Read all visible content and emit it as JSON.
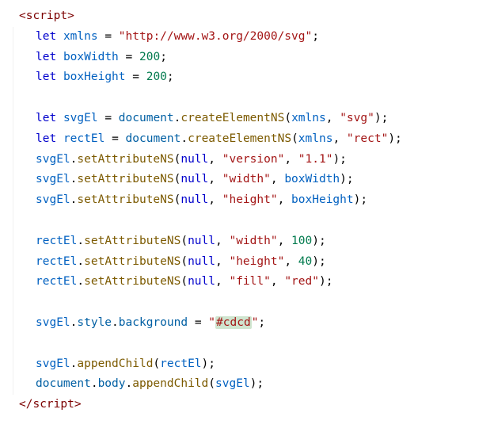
{
  "lines": [
    {
      "cls": "first",
      "tokens": [
        {
          "t": "<",
          "c": "tag-bracket"
        },
        {
          "t": "script",
          "c": "tag-name"
        },
        {
          "t": ">",
          "c": "tag-bracket"
        }
      ]
    },
    {
      "tokens": [
        {
          "t": "let",
          "c": "kw"
        },
        {
          "t": " "
        },
        {
          "t": "xmlns",
          "c": "var"
        },
        {
          "t": " "
        },
        {
          "t": "=",
          "c": "op"
        },
        {
          "t": " "
        },
        {
          "t": "\"http://www.w3.org/2000/svg\"",
          "c": "str"
        },
        {
          "t": ";",
          "c": "op"
        }
      ]
    },
    {
      "tokens": [
        {
          "t": "let",
          "c": "kw"
        },
        {
          "t": " "
        },
        {
          "t": "boxWidth",
          "c": "var"
        },
        {
          "t": " "
        },
        {
          "t": "=",
          "c": "op"
        },
        {
          "t": " "
        },
        {
          "t": "200",
          "c": "num"
        },
        {
          "t": ";",
          "c": "op"
        }
      ]
    },
    {
      "tokens": [
        {
          "t": "let",
          "c": "kw"
        },
        {
          "t": " "
        },
        {
          "t": "boxHeight",
          "c": "var"
        },
        {
          "t": " "
        },
        {
          "t": "=",
          "c": "op"
        },
        {
          "t": " "
        },
        {
          "t": "200",
          "c": "num"
        },
        {
          "t": ";",
          "c": "op"
        }
      ]
    },
    {
      "tokens": []
    },
    {
      "tokens": [
        {
          "t": "let",
          "c": "kw"
        },
        {
          "t": " "
        },
        {
          "t": "svgEl",
          "c": "var"
        },
        {
          "t": " "
        },
        {
          "t": "=",
          "c": "op"
        },
        {
          "t": " "
        },
        {
          "t": "document",
          "c": "obj"
        },
        {
          "t": ".",
          "c": "op"
        },
        {
          "t": "createElementNS",
          "c": "fn"
        },
        {
          "t": "(",
          "c": "op"
        },
        {
          "t": "xmlns",
          "c": "var"
        },
        {
          "t": ", ",
          "c": "op"
        },
        {
          "t": "\"svg\"",
          "c": "str"
        },
        {
          "t": ");",
          "c": "op"
        }
      ]
    },
    {
      "tokens": [
        {
          "t": "let",
          "c": "kw"
        },
        {
          "t": " "
        },
        {
          "t": "rectEl",
          "c": "var"
        },
        {
          "t": " "
        },
        {
          "t": "=",
          "c": "op"
        },
        {
          "t": " "
        },
        {
          "t": "document",
          "c": "obj"
        },
        {
          "t": ".",
          "c": "op"
        },
        {
          "t": "createElementNS",
          "c": "fn"
        },
        {
          "t": "(",
          "c": "op"
        },
        {
          "t": "xmlns",
          "c": "var"
        },
        {
          "t": ", ",
          "c": "op"
        },
        {
          "t": "\"rect\"",
          "c": "str"
        },
        {
          "t": ");",
          "c": "op"
        }
      ]
    },
    {
      "tokens": [
        {
          "t": "svgEl",
          "c": "var"
        },
        {
          "t": ".",
          "c": "op"
        },
        {
          "t": "setAttributeNS",
          "c": "fn"
        },
        {
          "t": "(",
          "c": "op"
        },
        {
          "t": "null",
          "c": "null"
        },
        {
          "t": ", ",
          "c": "op"
        },
        {
          "t": "\"version\"",
          "c": "str"
        },
        {
          "t": ", ",
          "c": "op"
        },
        {
          "t": "\"1.1\"",
          "c": "str"
        },
        {
          "t": ");",
          "c": "op"
        }
      ]
    },
    {
      "tokens": [
        {
          "t": "svgEl",
          "c": "var"
        },
        {
          "t": ".",
          "c": "op"
        },
        {
          "t": "setAttributeNS",
          "c": "fn"
        },
        {
          "t": "(",
          "c": "op"
        },
        {
          "t": "null",
          "c": "null"
        },
        {
          "t": ", ",
          "c": "op"
        },
        {
          "t": "\"width\"",
          "c": "str"
        },
        {
          "t": ", ",
          "c": "op"
        },
        {
          "t": "boxWidth",
          "c": "var"
        },
        {
          "t": ");",
          "c": "op"
        }
      ]
    },
    {
      "tokens": [
        {
          "t": "svgEl",
          "c": "var"
        },
        {
          "t": ".",
          "c": "op"
        },
        {
          "t": "setAttributeNS",
          "c": "fn"
        },
        {
          "t": "(",
          "c": "op"
        },
        {
          "t": "null",
          "c": "null"
        },
        {
          "t": ", ",
          "c": "op"
        },
        {
          "t": "\"height\"",
          "c": "str"
        },
        {
          "t": ", ",
          "c": "op"
        },
        {
          "t": "boxHeight",
          "c": "var"
        },
        {
          "t": ");",
          "c": "op"
        }
      ]
    },
    {
      "tokens": []
    },
    {
      "tokens": [
        {
          "t": "rectEl",
          "c": "var"
        },
        {
          "t": ".",
          "c": "op"
        },
        {
          "t": "setAttributeNS",
          "c": "fn"
        },
        {
          "t": "(",
          "c": "op"
        },
        {
          "t": "null",
          "c": "null"
        },
        {
          "t": ", ",
          "c": "op"
        },
        {
          "t": "\"width\"",
          "c": "str"
        },
        {
          "t": ", ",
          "c": "op"
        },
        {
          "t": "100",
          "c": "num"
        },
        {
          "t": ");",
          "c": "op"
        }
      ]
    },
    {
      "tokens": [
        {
          "t": "rectEl",
          "c": "var"
        },
        {
          "t": ".",
          "c": "op"
        },
        {
          "t": "setAttributeNS",
          "c": "fn"
        },
        {
          "t": "(",
          "c": "op"
        },
        {
          "t": "null",
          "c": "null"
        },
        {
          "t": ", ",
          "c": "op"
        },
        {
          "t": "\"height\"",
          "c": "str"
        },
        {
          "t": ", ",
          "c": "op"
        },
        {
          "t": "40",
          "c": "num"
        },
        {
          "t": ");",
          "c": "op"
        }
      ]
    },
    {
      "tokens": [
        {
          "t": "rectEl",
          "c": "var"
        },
        {
          "t": ".",
          "c": "op"
        },
        {
          "t": "setAttributeNS",
          "c": "fn"
        },
        {
          "t": "(",
          "c": "op"
        },
        {
          "t": "null",
          "c": "null"
        },
        {
          "t": ", ",
          "c": "op"
        },
        {
          "t": "\"fill\"",
          "c": "str"
        },
        {
          "t": ", ",
          "c": "op"
        },
        {
          "t": "\"red\"",
          "c": "str"
        },
        {
          "t": ");",
          "c": "op"
        }
      ]
    },
    {
      "tokens": []
    },
    {
      "tokens": [
        {
          "t": "svgEl",
          "c": "var"
        },
        {
          "t": ".",
          "c": "op"
        },
        {
          "t": "style",
          "c": "prop"
        },
        {
          "t": ".",
          "c": "op"
        },
        {
          "t": "background",
          "c": "prop"
        },
        {
          "t": " "
        },
        {
          "t": "=",
          "c": "op"
        },
        {
          "t": " "
        },
        {
          "t": "\"",
          "c": "str"
        },
        {
          "t": "#cdcd",
          "c": "str highlight"
        },
        {
          "t": "\"",
          "c": "str"
        },
        {
          "t": ";",
          "c": "op"
        }
      ]
    },
    {
      "tokens": []
    },
    {
      "tokens": [
        {
          "t": "svgEl",
          "c": "var"
        },
        {
          "t": ".",
          "c": "op"
        },
        {
          "t": "appendChild",
          "c": "fn"
        },
        {
          "t": "(",
          "c": "op"
        },
        {
          "t": "rectEl",
          "c": "var"
        },
        {
          "t": ");",
          "c": "op"
        }
      ]
    },
    {
      "tokens": [
        {
          "t": "document",
          "c": "obj"
        },
        {
          "t": ".",
          "c": "op"
        },
        {
          "t": "body",
          "c": "prop"
        },
        {
          "t": ".",
          "c": "op"
        },
        {
          "t": "appendChild",
          "c": "fn"
        },
        {
          "t": "(",
          "c": "op"
        },
        {
          "t": "svgEl",
          "c": "var"
        },
        {
          "t": ");",
          "c": "op"
        }
      ]
    },
    {
      "cls": "last",
      "tokens": [
        {
          "t": "</",
          "c": "tag-bracket"
        },
        {
          "t": "script",
          "c": "tag-name"
        },
        {
          "t": ">",
          "c": "tag-bracket"
        }
      ]
    }
  ]
}
